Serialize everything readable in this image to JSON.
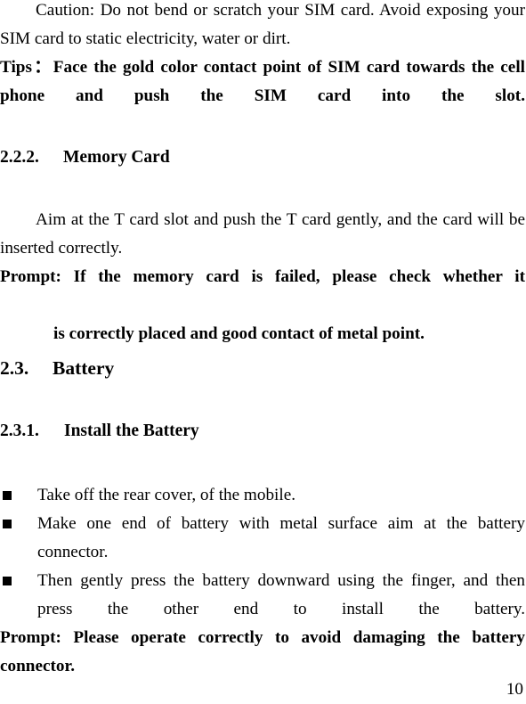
{
  "document": {
    "page_number": "10",
    "paragraphs": {
      "caution": "Caution: Do not bend or scratch your SIM card. Avoid exposing your SIM card to static electricity, water or dirt.",
      "tips": "Tips：Face the gold color contact point of SIM card towards the cell phone and push the SIM card into the slot.",
      "memory_card_body": "Aim at the T card slot and push the T card gently, and the card will be inserted correctly.",
      "memory_card_prompt_line1": "Prompt: If the memory card is failed, please check whether it",
      "memory_card_prompt_line2": "is correctly placed and good contact of metal point.",
      "battery_prompt": "Prompt: Please operate correctly to avoid damaging the battery connector."
    },
    "headings": {
      "memory_card": {
        "number": "2.2.2.",
        "title": "Memory Card"
      },
      "battery": {
        "number": "2.3.",
        "title": "Battery"
      },
      "install_battery": {
        "number": "2.3.1.",
        "title": "Install the Battery"
      }
    },
    "bullets": [
      "Take off the rear cover, of the mobile.",
      "Make one end of battery with metal surface aim at the battery connector.",
      "Then gently press the battery downward using the finger, and then press the other end to install the battery."
    ]
  }
}
